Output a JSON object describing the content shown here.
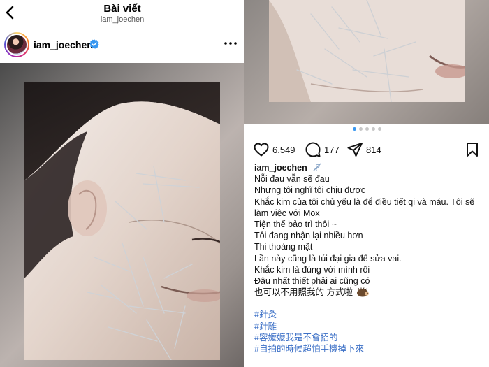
{
  "header": {
    "title": "Bài viết",
    "subtitle": "iam_joechen"
  },
  "post": {
    "username": "iam_joechen",
    "likes": "6.549",
    "comments": "177",
    "shares": "814",
    "carousel": {
      "count": 5,
      "active_index": 0
    }
  },
  "caption": {
    "username": "iam_joechen",
    "lines": [
      "Nỗi đau vẫn sẽ đau",
      "Nhưng tôi nghĩ tôi chịu được",
      "Khắc kim của tôi chủ yếu là để điều tiết qi và máu. Tôi sẽ làm việc với Mox",
      "Tiện thể bảo trì thôi ~",
      "Tôi đang nhận lại nhiều hơn",
      "Thi thoảng mặt",
      "Lần này cũng là túi đại gia để sửa vai.",
      "Khắc kim là đúng với mình rồi",
      "Đâu nhất thiết phải ai cũng có",
      "也可以不用照我的 方式啦"
    ],
    "hashtags": [
      "#針灸",
      "#針雕",
      "#容嬤嬤我是不會招的",
      "#自拍的時候超怕手機掉下來"
    ]
  },
  "icons": {
    "back": "chevron-left-icon",
    "verified": "verified-badge-icon",
    "more": "more-horizontal-icon",
    "like": "heart-icon",
    "comment": "comment-icon",
    "share": "send-icon",
    "save": "bookmark-icon"
  },
  "colors": {
    "accent": "#3897f0",
    "hashtag": "#3b6fc6"
  }
}
